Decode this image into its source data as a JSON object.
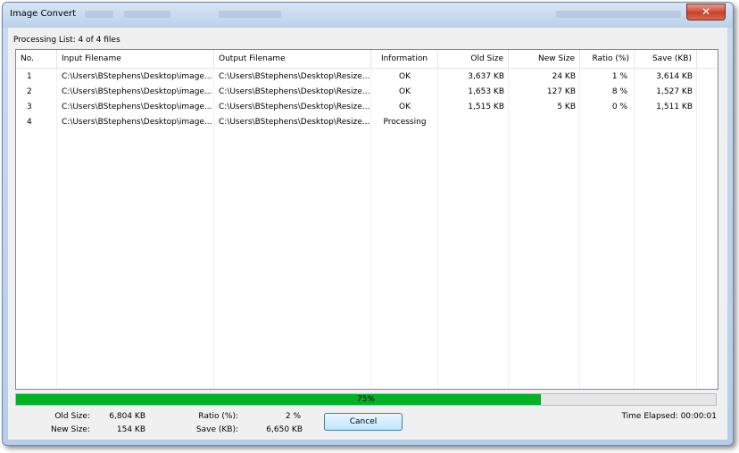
{
  "window": {
    "title": "Image Convert",
    "close_glyph": "✕"
  },
  "processing_label": "Processing List: 4 of 4 files",
  "table": {
    "columns": [
      "No.",
      "Input Filename",
      "Output Filename",
      "Information",
      "Old Size",
      "New Size",
      "Ratio (%)",
      "Save (KB)"
    ],
    "rows": [
      [
        "1",
        "C:\\Users\\BStephens\\Desktop\\image...",
        "C:\\Users\\BStephens\\Desktop\\Resize...",
        "OK",
        "3,637 KB",
        "24 KB",
        "1 %",
        "3,614 KB"
      ],
      [
        "2",
        "C:\\Users\\BStephens\\Desktop\\image...",
        "C:\\Users\\BStephens\\Desktop\\Resize...",
        "OK",
        "1,653 KB",
        "127 KB",
        "8 %",
        "1,527 KB"
      ],
      [
        "3",
        "C:\\Users\\BStephens\\Desktop\\image...",
        "C:\\Users\\BStephens\\Desktop\\Resize...",
        "OK",
        "1,515 KB",
        "5 KB",
        "0 %",
        "1,511 KB"
      ],
      [
        "4",
        "C:\\Users\\BStephens\\Desktop\\image...",
        "C:\\Users\\BStephens\\Desktop\\Resize...",
        "Processing",
        "",
        "",
        "",
        ""
      ]
    ]
  },
  "progress": {
    "value": 75,
    "label": "75%",
    "color": "#06b025"
  },
  "stats": {
    "old_size_label": "Old Size:",
    "old_size_value": "6,804 KB",
    "new_size_label": "New Size:",
    "new_size_value": "154 KB",
    "ratio_label": "Ratio (%):",
    "ratio_value": "2 %",
    "save_label": "Save (KB):",
    "save_value": "6,650 KB"
  },
  "cancel_label": "Cancel",
  "time_elapsed": "Time Elapsed: 00:00:01"
}
